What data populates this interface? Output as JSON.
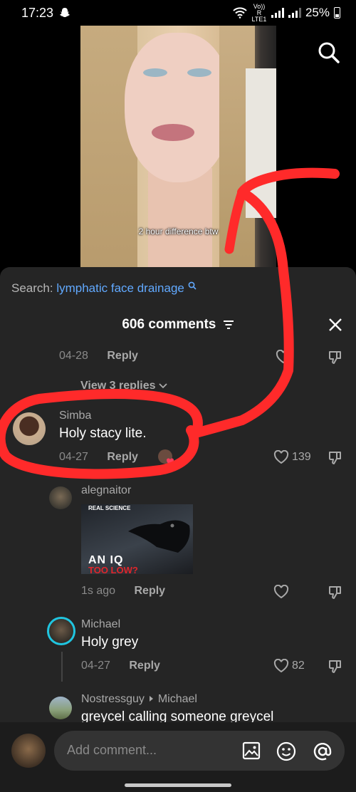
{
  "status_bar": {
    "time": "17:23",
    "network": "Vo)) R LTE1",
    "battery": "25%"
  },
  "video": {
    "caption": "2 hour difference btw"
  },
  "comments_sheet": {
    "search_prefix": "Search:",
    "search_term": "lymphatic face drainage",
    "count_label": "606 comments",
    "top_comment_meta": {
      "date": "04-28",
      "reply": "Reply"
    },
    "view_replies": "View 3 replies",
    "comments": [
      {
        "user": "Simba",
        "text": "Holy stacy lite.",
        "date": "04-27",
        "reply": "Reply",
        "likes": "139"
      },
      {
        "user": "alegnaitor",
        "thumb_brand": "REAL SCIENCE",
        "thumb_text_1": "AN IQ",
        "thumb_text_2": "TOO LOW?",
        "date": "1s ago",
        "reply": "Reply"
      },
      {
        "user": "Michael",
        "text": "Holy grey",
        "date": "04-27",
        "reply": "Reply",
        "likes": "82"
      },
      {
        "user": "Nostressguy",
        "reply_to": "Michael",
        "text": "greycel calling someone greycel"
      }
    ]
  },
  "input_bar": {
    "placeholder": "Add comment..."
  },
  "colors": {
    "accent": "#61a9ff",
    "annotation": "#ff2a2a",
    "sheet_bg": "#252525"
  }
}
